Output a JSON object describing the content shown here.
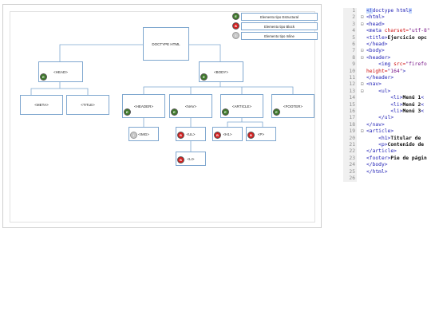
{
  "legend": [
    {
      "badge": "E",
      "color": "#3f7a2a",
      "label": "Elemento tipo Estructural"
    },
    {
      "badge": "B",
      "color": "#d42020",
      "label": "Elemento tipo Block"
    },
    {
      "badge": "I",
      "color": "#c8c8c8",
      "label": "Elemento tipo Inline"
    }
  ],
  "nodes": {
    "doctype": {
      "label": "DOCTYPE HTML",
      "badge": ""
    },
    "head": {
      "label": "<HEAD>",
      "badge": "E"
    },
    "body": {
      "label": "<BODY>",
      "badge": "E"
    },
    "meta": {
      "label": "<META>",
      "badge": ""
    },
    "title": {
      "label": "<TITLE>",
      "badge": ""
    },
    "header": {
      "label": "<HEADER>",
      "badge": "E"
    },
    "nav": {
      "label": "<NAV>",
      "badge": "E"
    },
    "article": {
      "label": "<ARTICLE>",
      "badge": "E"
    },
    "footer": {
      "label": "<FOOTER>",
      "badge": "E"
    },
    "img": {
      "label": "<IMG>",
      "badge": "I"
    },
    "ul": {
      "label": "<UL>",
      "badge": "B"
    },
    "h1": {
      "label": "<H1>",
      "badge": "B"
    },
    "p": {
      "label": "<P>",
      "badge": "B"
    },
    "li": {
      "label": "<LI>",
      "badge": "B"
    }
  },
  "code": {
    "line_numbers": [
      "1",
      "2",
      "3",
      "4",
      "5",
      "6",
      "7",
      "8",
      "9",
      "10",
      "11",
      "12",
      "13",
      "14",
      "15",
      "16",
      "17",
      "18",
      "19",
      "20",
      "21",
      "22",
      "23",
      "24",
      "25",
      "26"
    ],
    "lines": [
      {
        "fold": "",
        "parts": [
          [
            "hl",
            "<!"
          ],
          [
            "tag",
            "doctype html"
          ],
          [
            "hl",
            ">"
          ]
        ]
      },
      {
        "fold": "⊟",
        "parts": [
          [
            "tag",
            "<html>"
          ]
        ]
      },
      {
        "fold": "⊟",
        "parts": [
          [
            "tag",
            "<head>"
          ]
        ]
      },
      {
        "fold": "",
        "parts": [
          [
            "tag",
            "<meta "
          ],
          [
            "attr",
            "charset="
          ],
          [
            "str",
            "\"utf-8\""
          ]
        ]
      },
      {
        "fold": "",
        "parts": [
          [
            "tag",
            "<title>"
          ],
          [
            "bold",
            "Ejercicio opc"
          ]
        ]
      },
      {
        "fold": "",
        "parts": [
          [
            "tag",
            "</head>"
          ]
        ]
      },
      {
        "fold": "⊟",
        "parts": [
          [
            "tag",
            "<body>"
          ]
        ]
      },
      {
        "fold": "⊟",
        "parts": [
          [
            "tag",
            "<header>"
          ]
        ]
      },
      {
        "fold": "",
        "parts": [
          [
            "plain",
            "    "
          ],
          [
            "tag",
            "<img "
          ],
          [
            "attr",
            "src="
          ],
          [
            "str",
            "\"firefo"
          ]
        ]
      },
      {
        "fold": "",
        "parts": [
          [
            "attr",
            "height="
          ],
          [
            "str",
            "\"164\""
          ],
          [
            "tag",
            ">"
          ]
        ]
      },
      {
        "fold": "",
        "parts": [
          [
            "tag",
            "</header>"
          ]
        ]
      },
      {
        "fold": "⊟",
        "parts": [
          [
            "tag",
            "<nav>"
          ]
        ]
      },
      {
        "fold": "⊟",
        "parts": [
          [
            "plain",
            "    "
          ],
          [
            "tag",
            "<ul>"
          ]
        ]
      },
      {
        "fold": "",
        "parts": [
          [
            "plain",
            "        "
          ],
          [
            "tag",
            "<li>"
          ],
          [
            "bold",
            "Menú 1"
          ],
          [
            "tag",
            "<"
          ]
        ]
      },
      {
        "fold": "",
        "parts": [
          [
            "plain",
            "        "
          ],
          [
            "tag",
            "<li>"
          ],
          [
            "bold",
            "Menú 2"
          ],
          [
            "tag",
            "<"
          ]
        ]
      },
      {
        "fold": "",
        "parts": [
          [
            "plain",
            "        "
          ],
          [
            "tag",
            "<li>"
          ],
          [
            "bold",
            "Menú 3"
          ],
          [
            "tag",
            "<"
          ]
        ]
      },
      {
        "fold": "",
        "parts": [
          [
            "plain",
            "    "
          ],
          [
            "tag",
            "</ul>"
          ]
        ]
      },
      {
        "fold": "",
        "parts": [
          [
            "tag",
            "</nav>"
          ]
        ]
      },
      {
        "fold": "⊟",
        "parts": [
          [
            "tag",
            "<article>"
          ]
        ]
      },
      {
        "fold": "",
        "parts": [
          [
            "plain",
            "    "
          ],
          [
            "tag",
            "<h1>"
          ],
          [
            "bold",
            "Titular de "
          ]
        ]
      },
      {
        "fold": "",
        "parts": [
          [
            "plain",
            "    "
          ],
          [
            "tag",
            "<p>"
          ],
          [
            "bold",
            "Contenido de"
          ]
        ]
      },
      {
        "fold": "",
        "parts": [
          [
            "tag",
            "</article>"
          ]
        ]
      },
      {
        "fold": "",
        "parts": [
          [
            "tag",
            "<footer>"
          ],
          [
            "bold",
            "Pie de págin"
          ]
        ]
      },
      {
        "fold": "",
        "parts": [
          [
            "tag",
            "</body>"
          ]
        ]
      },
      {
        "fold": "",
        "parts": [
          [
            "tag",
            "</html>"
          ]
        ]
      },
      {
        "fold": "",
        "parts": []
      }
    ]
  }
}
